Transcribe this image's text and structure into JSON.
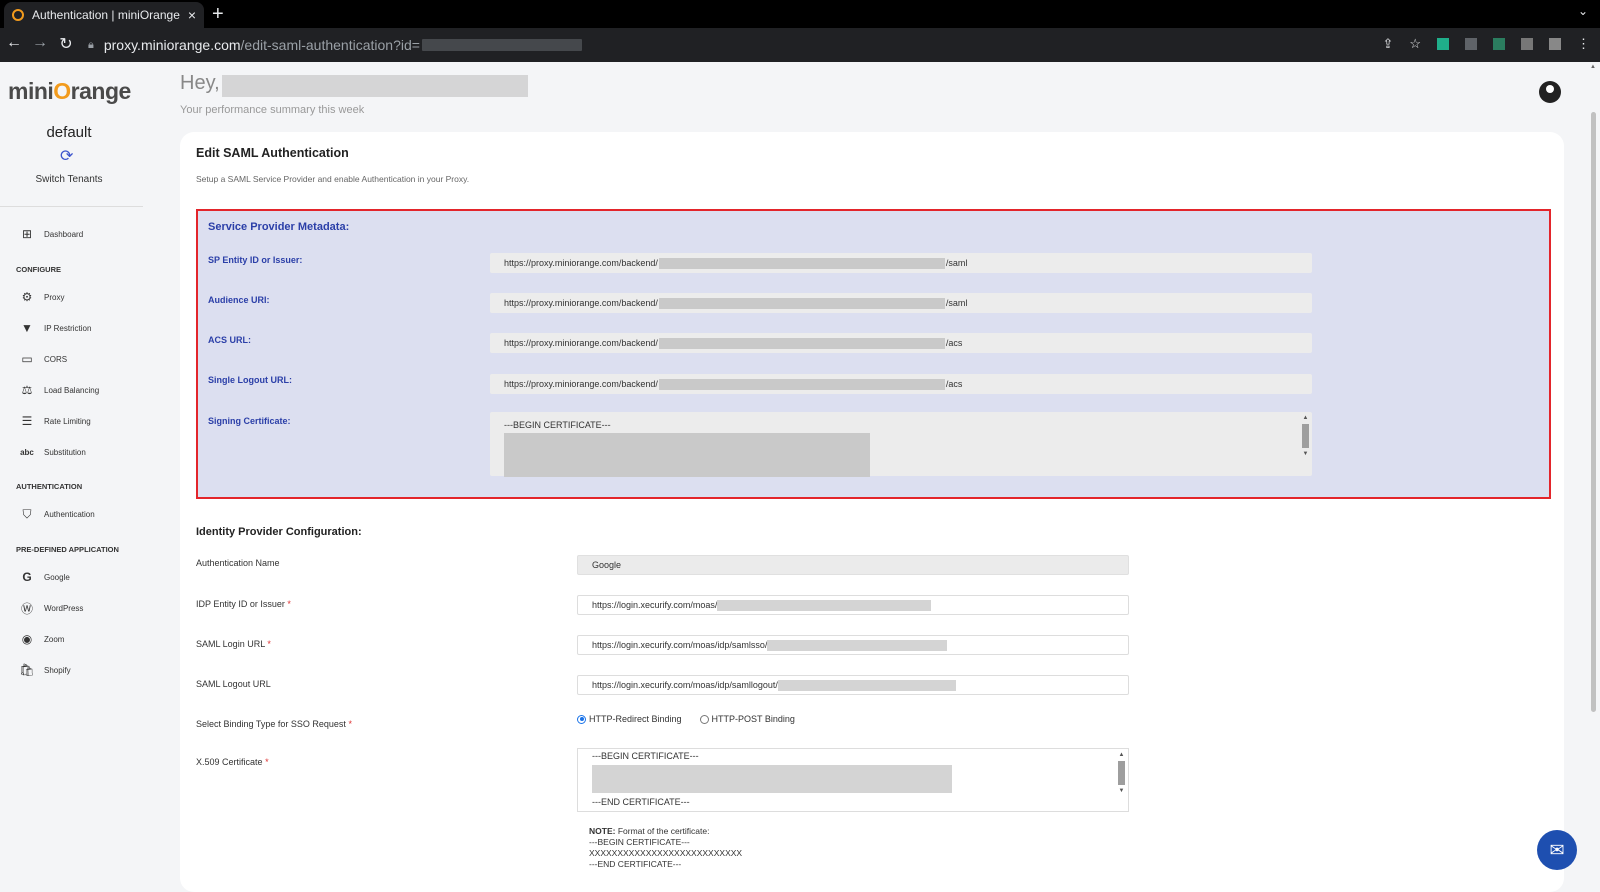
{
  "browser": {
    "tab_title": "Authentication | miniOrange",
    "tab_close": "×",
    "new_tab": "+",
    "url_host": "proxy.miniorange.com",
    "url_path": "/edit-saml-authentication?id=",
    "nav_back": "←",
    "nav_forward": "→",
    "nav_reload": "↻",
    "menu": "⋮"
  },
  "sidebar": {
    "logo_left": "mini",
    "logo_o": "O",
    "logo_right": "range",
    "tenant": "default",
    "switch_tenants": "Switch Tenants",
    "dashboard": "Dashboard",
    "sections": {
      "configure": "CONFIGURE",
      "authentication": "AUTHENTICATION",
      "predefined": "PRE-DEFINED APPLICATION"
    },
    "configure_items": [
      "Proxy",
      "IP Restriction",
      "CORS",
      "Load Balancing",
      "Rate Limiting",
      "Substitution"
    ],
    "auth_items": [
      "Authentication"
    ],
    "predefined_items": [
      "Google",
      "WordPress",
      "Zoom",
      "Shopify"
    ]
  },
  "header": {
    "greeting": "Hey,",
    "subtitle": "Your performance summary this week"
  },
  "card": {
    "title": "Edit SAML Authentication",
    "subtitle": "Setup a SAML Service Provider and enable Authentication in your Proxy."
  },
  "sp_metadata": {
    "title": "Service Provider Metadata:",
    "entity_label": "SP Entity ID or Issuer:",
    "entity_prefix": "https://proxy.miniorange.com/backend/",
    "entity_suffix": "/saml",
    "audience_label": "Audience URI:",
    "audience_prefix": "https://proxy.miniorange.com/backend/",
    "audience_suffix": "/saml",
    "acs_label": "ACS URL:",
    "acs_prefix": "https://proxy.miniorange.com/backend/",
    "acs_suffix": "/acs",
    "slo_label": "Single Logout URL:",
    "slo_prefix": "https://proxy.miniorange.com/backend/",
    "slo_suffix": "/acs",
    "cert_label": "Signing Certificate:",
    "cert_begin": "---BEGIN CERTIFICATE---"
  },
  "idp": {
    "title": "Identity Provider Configuration:",
    "auth_name_label": "Authentication Name",
    "auth_name_value": "Google",
    "entity_label": "IDP Entity ID or Issuer",
    "entity_value": "https://login.xecurify.com/moas/",
    "login_label": "SAML Login URL",
    "login_value": "https://login.xecurify.com/moas/idp/samlsso/",
    "logout_label": "SAML Logout URL",
    "logout_value": "https://login.xecurify.com/moas/idp/samllogout/",
    "binding_label": "Select Binding Type for SSO Request",
    "binding_redirect": "HTTP-Redirect Binding",
    "binding_post": "HTTP-POST Binding",
    "binding_selected": "HTTP-Redirect Binding",
    "x509_label": "X.509 Certificate",
    "x509_begin": "---BEGIN CERTIFICATE---",
    "x509_end": "---END CERTIFICATE---",
    "required_mark": "*",
    "note_label": "NOTE:",
    "note_text": "Format of the certificate:",
    "note_begin": "---BEGIN CERTIFICATE---",
    "note_x": "XXXXXXXXXXXXXXXXXXXXXXXXXXX",
    "note_end": "---END CERTIFICATE---"
  },
  "colors": {
    "brand_orange": "#f29b1d",
    "sp_box_bg": "#dcdff0",
    "sp_box_border": "#e3252b",
    "sp_text": "#2b3fa8",
    "chat_button": "#1e4fb0"
  }
}
